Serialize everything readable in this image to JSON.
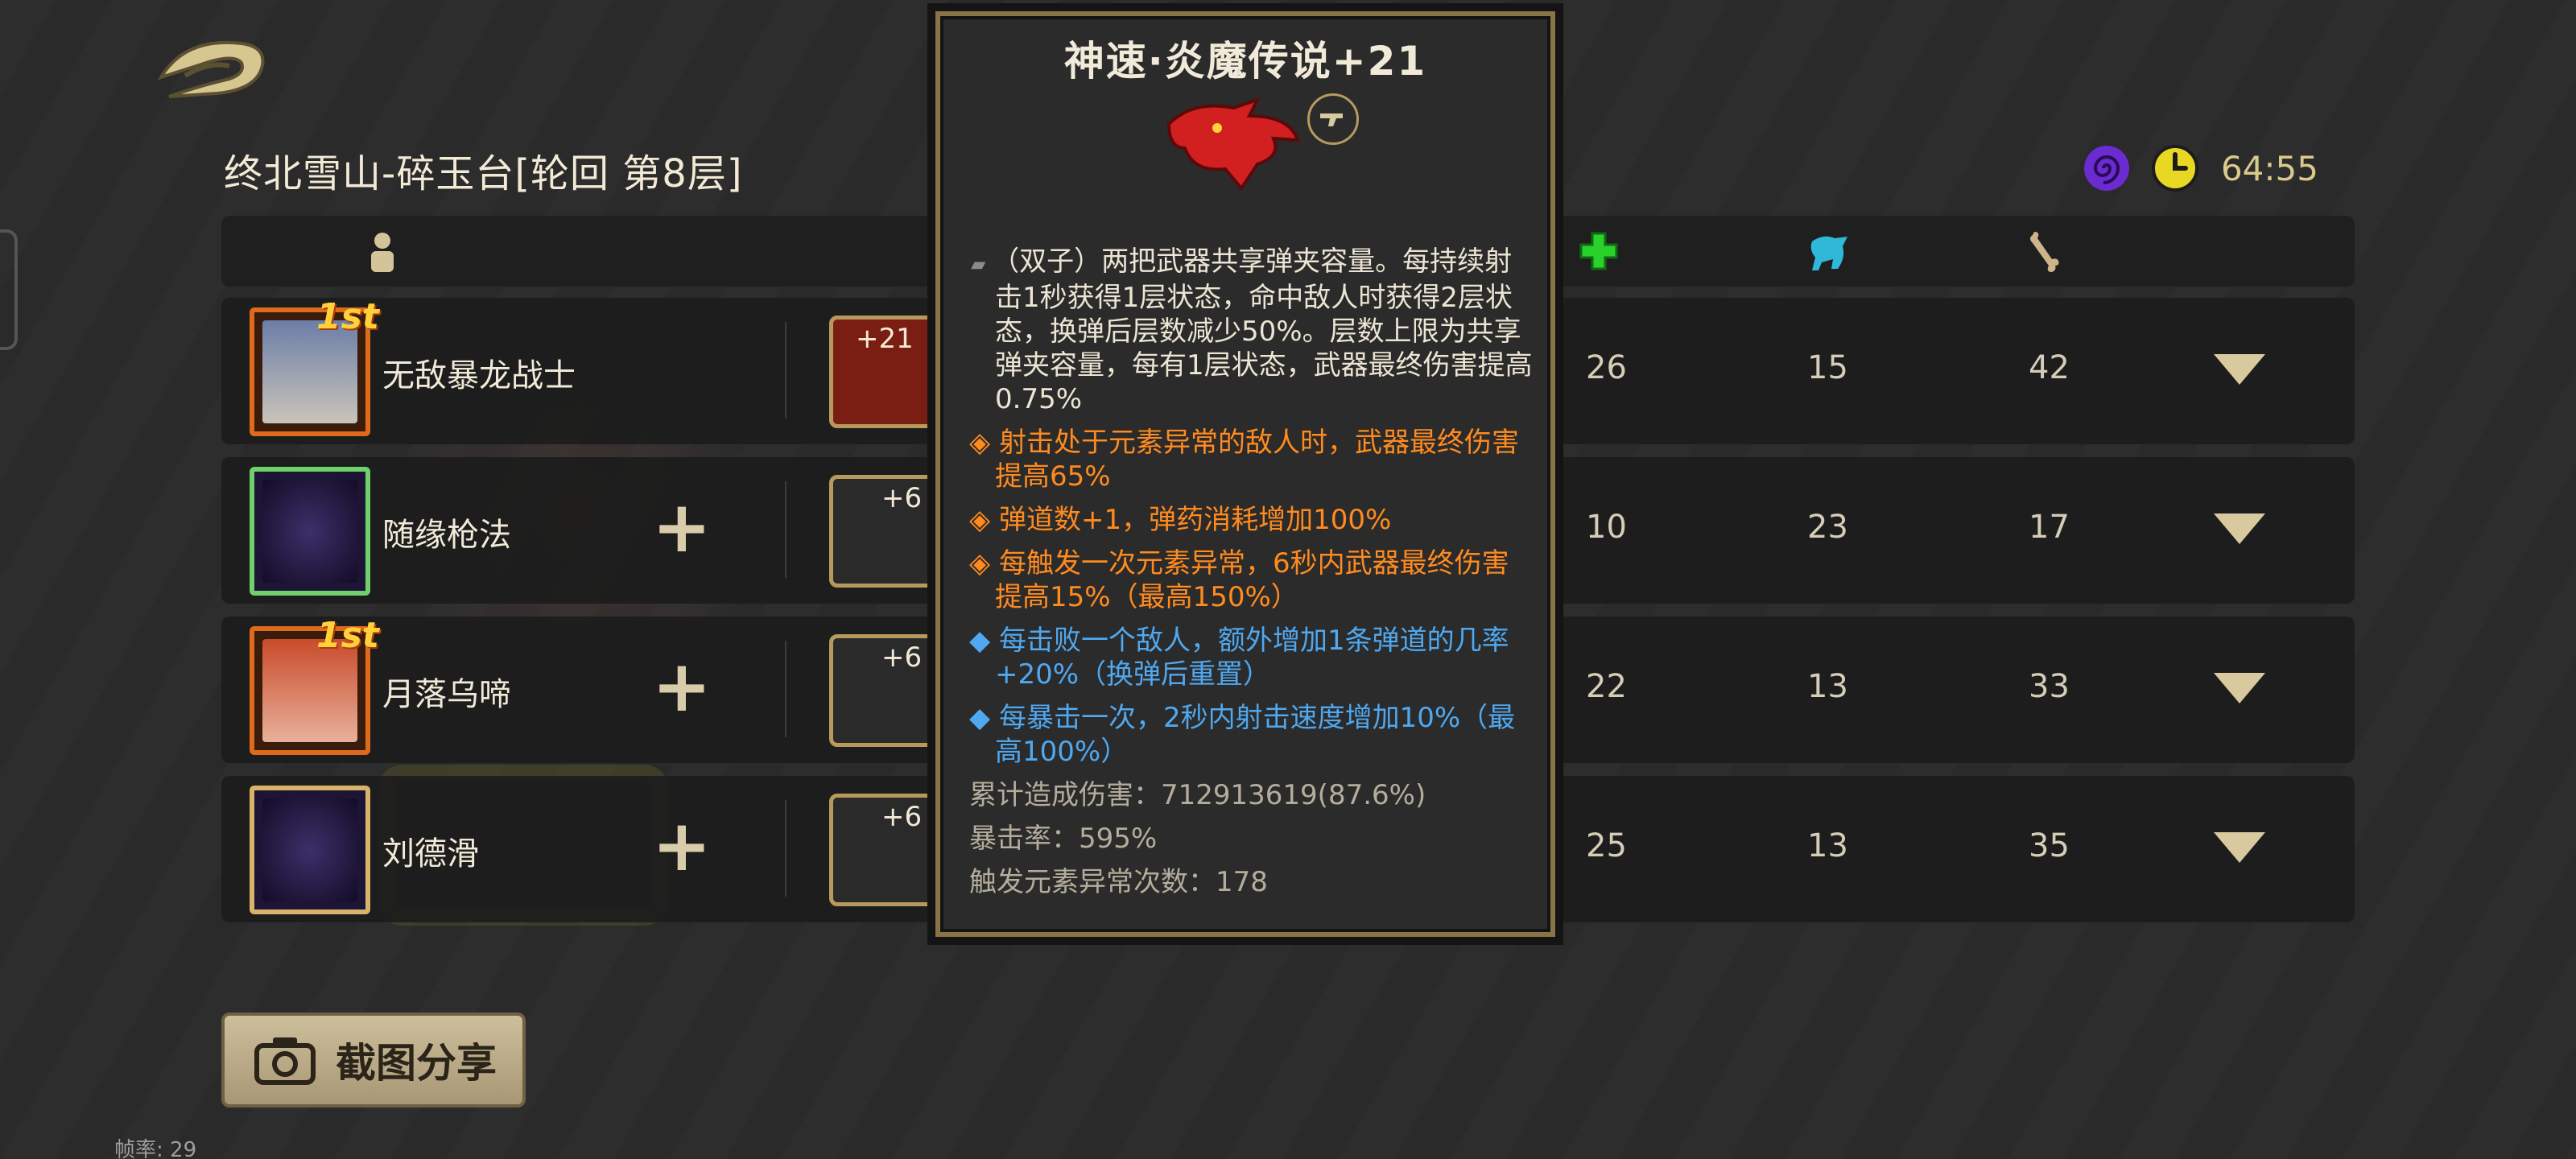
{
  "header": {
    "title": "终北雪山-碎玉台[轮回 第8层]",
    "timer": "64:55"
  },
  "columns": {
    "icons": [
      "player-icon",
      "heal-icon",
      "speed-icon",
      "bone-icon"
    ]
  },
  "rows": [
    {
      "name": "无敌暴龙战士",
      "rank": "1st",
      "weapon_level": "+21",
      "frame_color": "#e06a1c",
      "stats": [
        "26",
        "15",
        "42"
      ],
      "has_plus": false
    },
    {
      "name": "随缘枪法",
      "rank": "",
      "weapon_level": "+6",
      "frame_color": "#6fd16b",
      "stats": [
        "10",
        "23",
        "17"
      ],
      "has_plus": true
    },
    {
      "name": "月落乌啼",
      "rank": "1st",
      "weapon_level": "+6",
      "frame_color": "#e06a1c",
      "stats": [
        "22",
        "13",
        "33"
      ],
      "has_plus": true
    },
    {
      "name": "刘德滑",
      "rank": "",
      "weapon_level": "+6",
      "frame_color": "#d8b46a",
      "stats": [
        "25",
        "13",
        "35"
      ],
      "has_plus": true
    }
  ],
  "tooltip": {
    "title": "神速·炎魔传说+21",
    "description": "（双子）两把武器共享弹夹容量。每持续射击1秒获得1层状态，命中敌人时获得2层状态，换弹后层数减少50%。层数上限为共享弹夹容量，每有1层状态，武器最终伤害提高0.75%",
    "orange_lines": [
      "射击处于元素异常的敌人时，武器最终伤害提高65%",
      "弹道数+1，弹药消耗增加100%",
      "每触发一次元素异常，6秒内武器最终伤害提高15%（最高150%）"
    ],
    "blue_lines": [
      "每击败一个敌人，额外增加1条弹道的几率+20%（换弹后重置）",
      "每暴击一次，2秒内射击速度增加10%（最高100%）"
    ],
    "stats": [
      "累计造成伤害：712913619(87.6%)",
      "暴击率：595%",
      "触发元素异常次数：178"
    ]
  },
  "share_button": {
    "label": "截图分享"
  },
  "fps": "帧率: 29",
  "colors": {
    "accent_orange": "#ff8b1f",
    "accent_blue": "#4fa8f0",
    "frame_gold": "#8a7446"
  }
}
